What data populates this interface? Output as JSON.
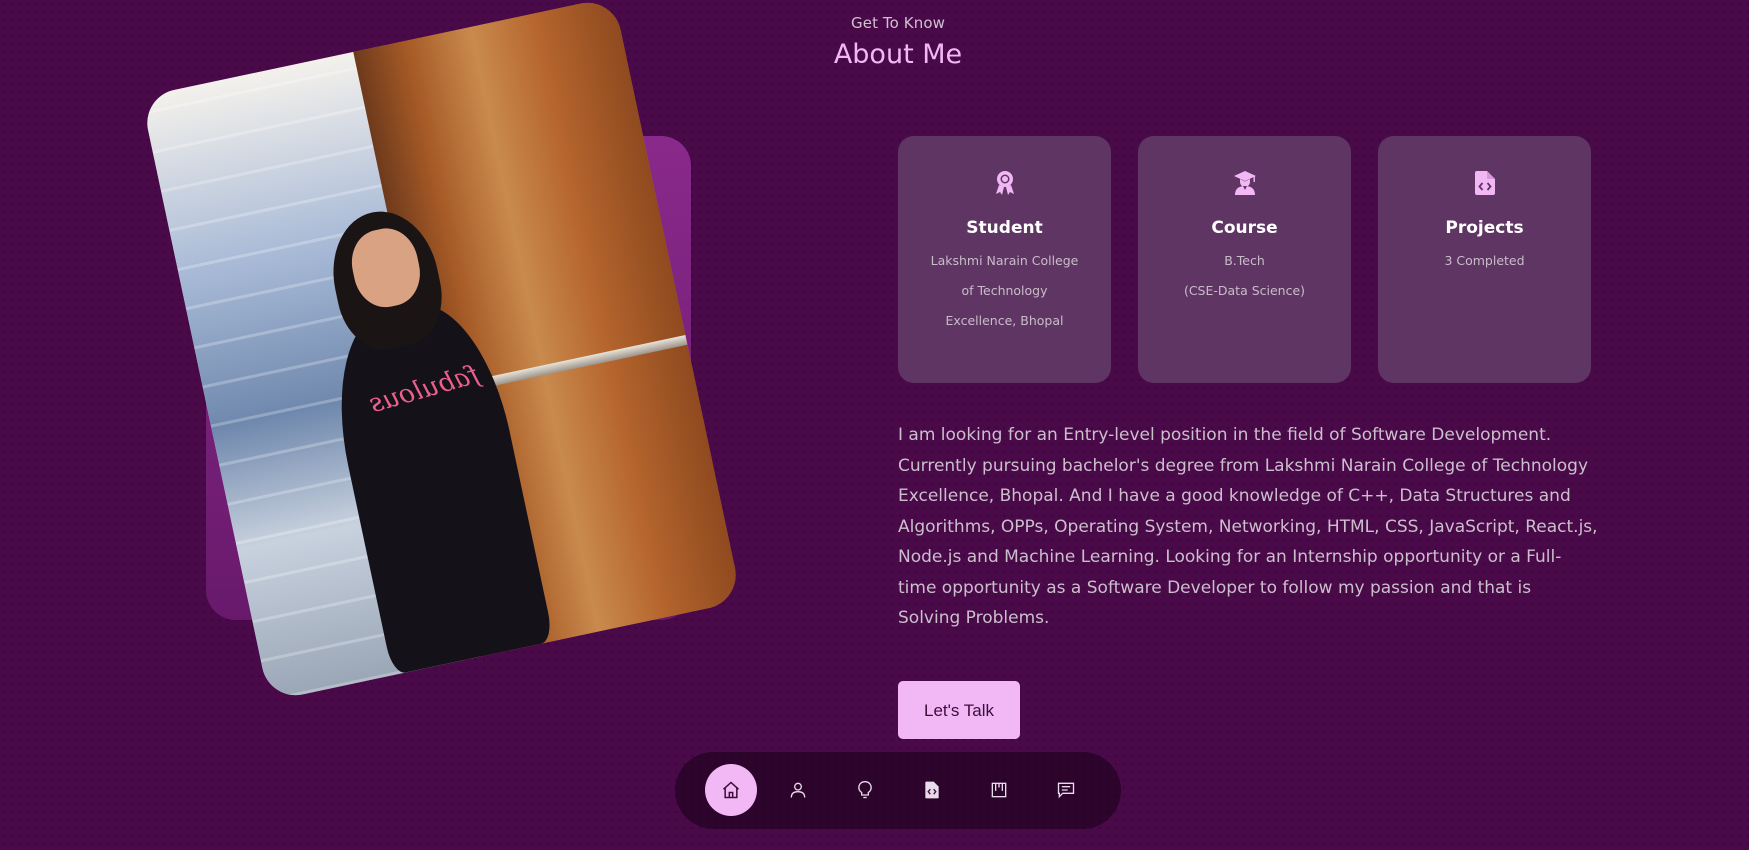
{
  "header": {
    "subtitle": "Get To Know",
    "title": "About Me"
  },
  "profile_image": {
    "alt": "Profile photo",
    "shirt_text": "fabulous"
  },
  "cards": [
    {
      "icon": "award-icon",
      "title": "Student",
      "lines": [
        "Lakshmi Narain College",
        "of Technology",
        "Excellence, Bhopal"
      ]
    },
    {
      "icon": "graduate-icon",
      "title": "Course",
      "lines": [
        "B.Tech",
        "(CSE-Data Science)"
      ]
    },
    {
      "icon": "code-file-icon",
      "title": "Projects",
      "lines": [
        "3 Completed"
      ]
    }
  ],
  "bio": {
    "text": "I am looking for an Entry-level position in the field of Software Development. Currently pursuing bachelor's degree from Lakshmi Narain College of Technology Excellence, Bhopal. And I have a good knowledge of C++, Data Structures and Algorithms, OPPs, Operating System, Networking, HTML, CSS, JavaScript, React.js, Node.js and Machine Learning. Looking for an Internship opportunity or a Full-time opportunity as a Software Developer to follow my passion and that is Solving Problems."
  },
  "cta": {
    "label": "Let's Talk"
  },
  "nav": {
    "items": [
      {
        "icon": "home-icon",
        "active": true
      },
      {
        "icon": "user-icon",
        "active": false
      },
      {
        "icon": "lightbulb-icon",
        "active": false
      },
      {
        "icon": "code-file-icon",
        "active": false
      },
      {
        "icon": "portfolio-icon",
        "active": false
      },
      {
        "icon": "message-icon",
        "active": false
      }
    ]
  },
  "colors": {
    "background": "#4a0a4a",
    "accent": "#f2b8f5",
    "card": "#5f3563",
    "text_muted": "#cbbfcc"
  }
}
